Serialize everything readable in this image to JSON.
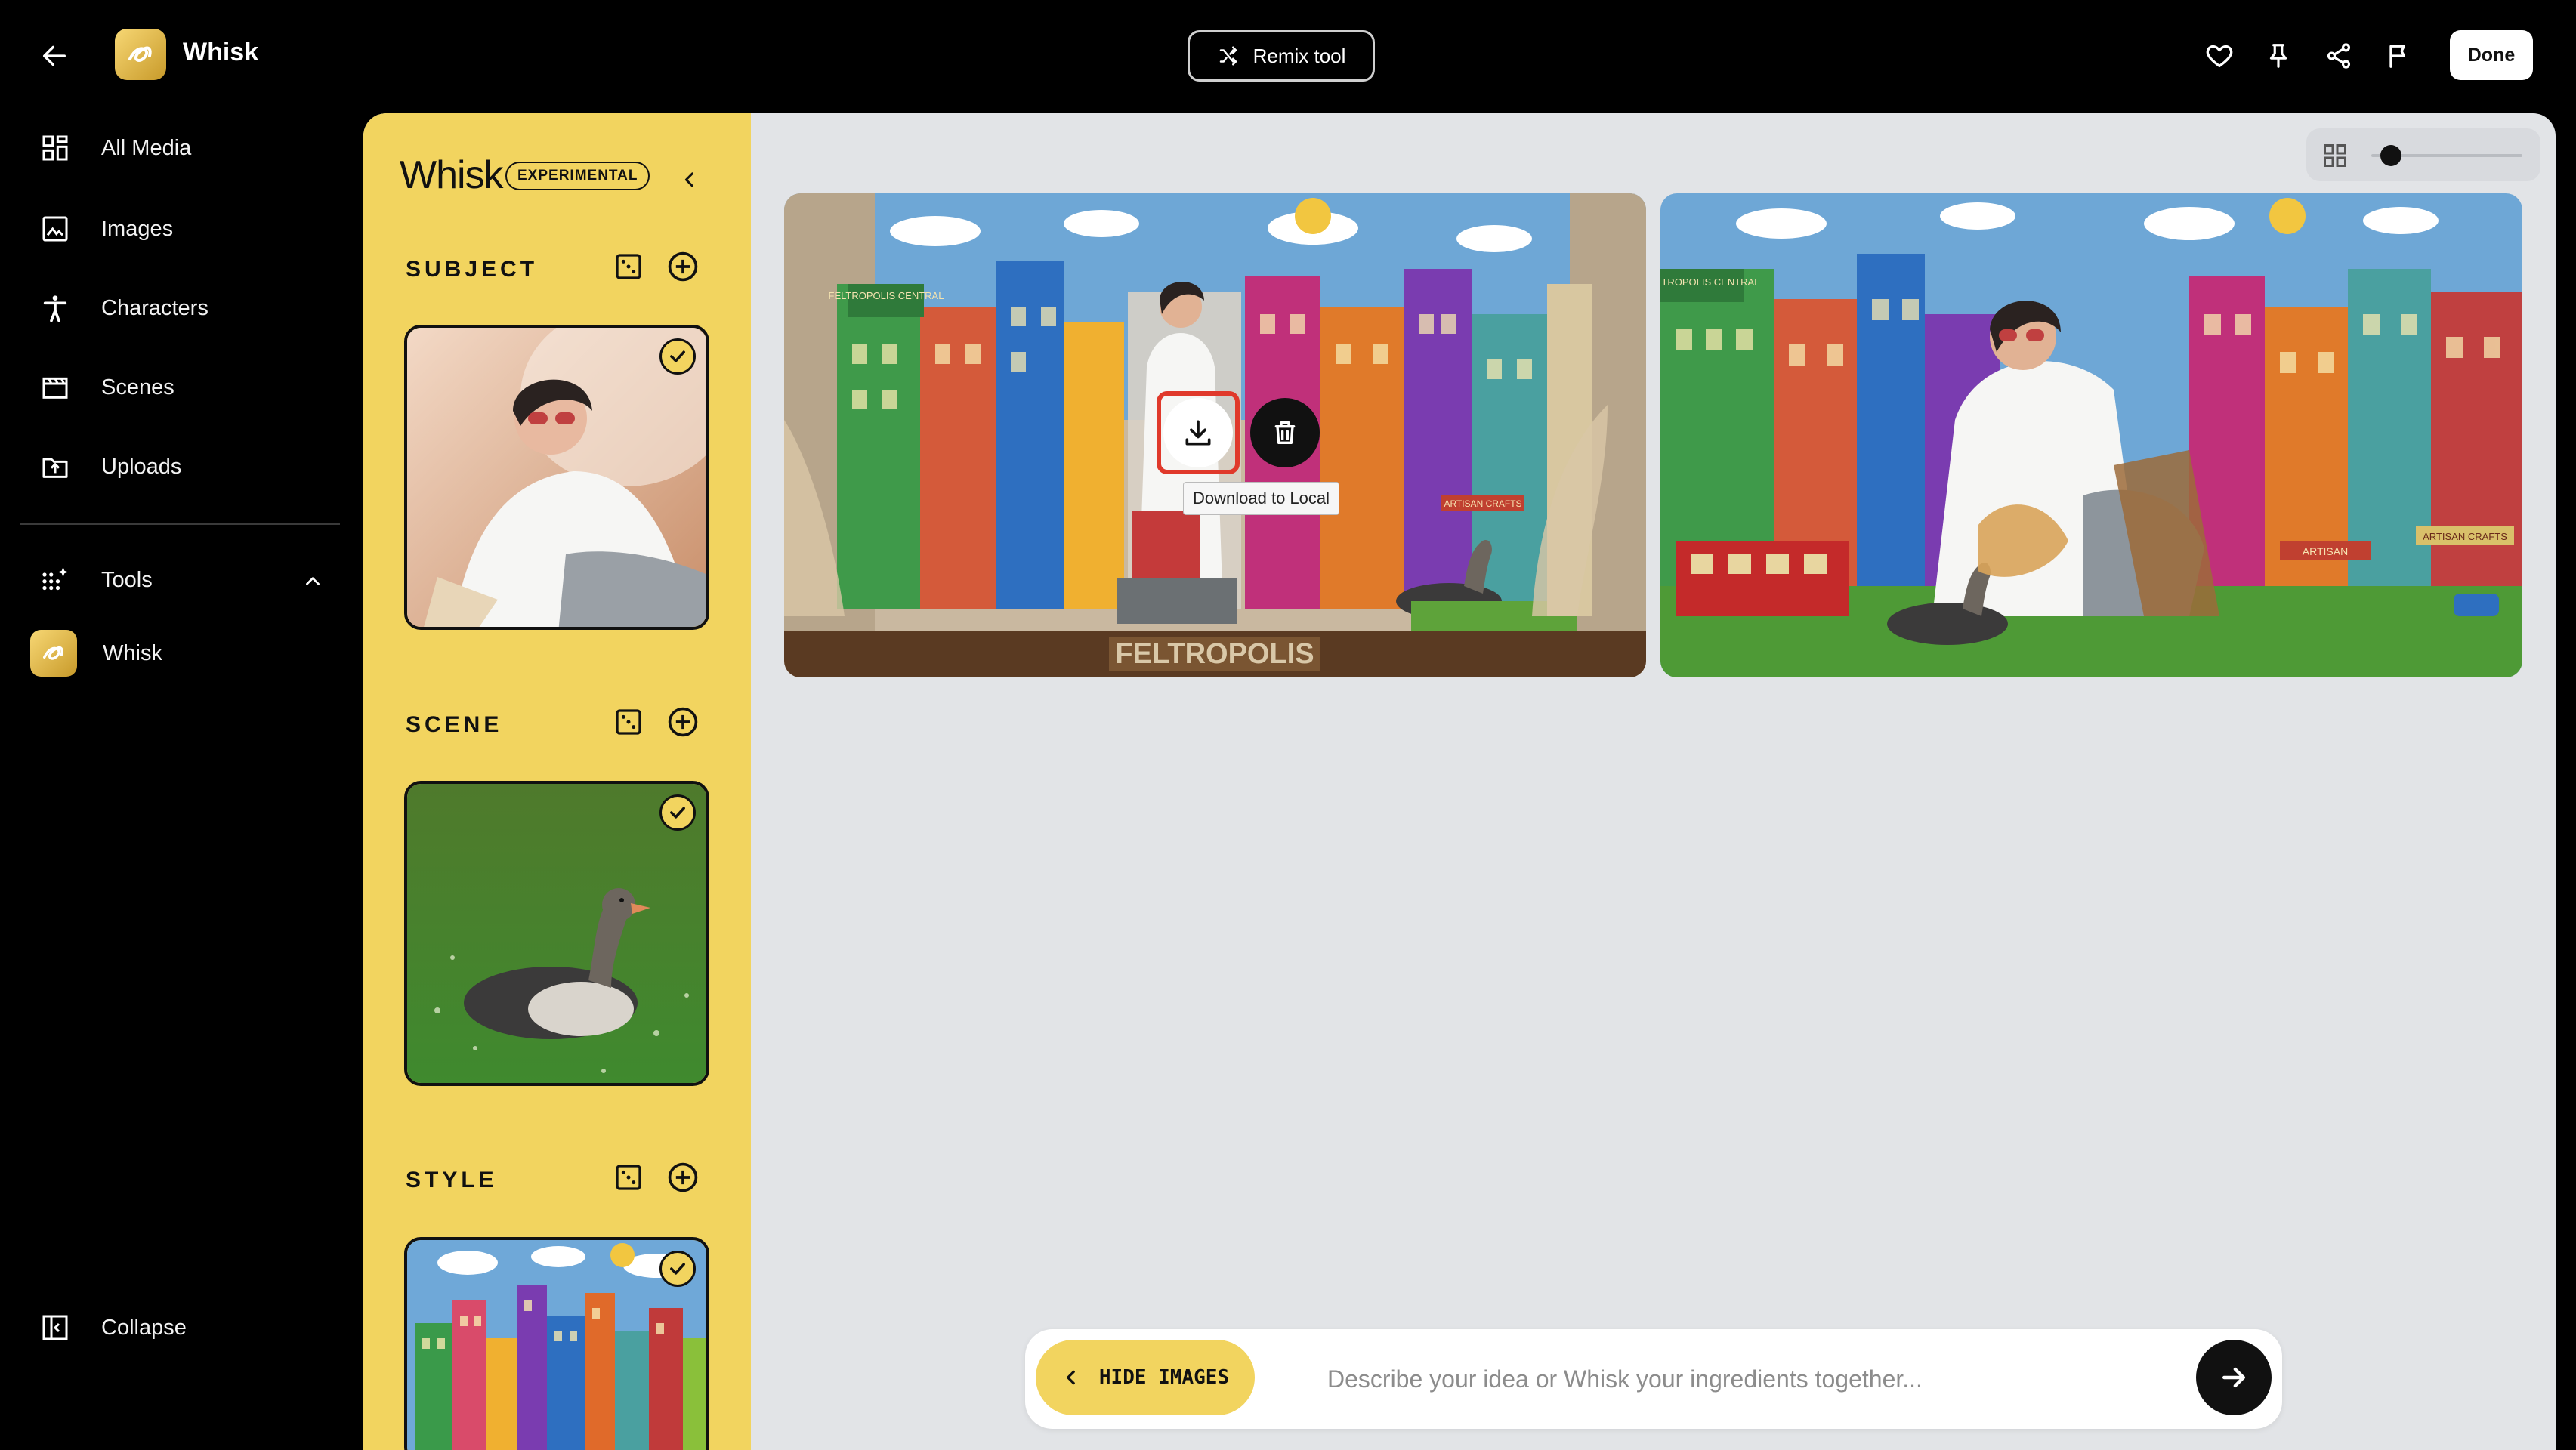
{
  "header": {
    "app_title": "Whisk",
    "remix_label": "Remix tool",
    "done_label": "Done"
  },
  "sidebar": {
    "items": [
      {
        "label": "All Media",
        "icon": "grid-icon"
      },
      {
        "label": "Images",
        "icon": "image-icon"
      },
      {
        "label": "Characters",
        "icon": "person-icon"
      },
      {
        "label": "Scenes",
        "icon": "clapperboard-icon"
      },
      {
        "label": "Uploads",
        "icon": "upload-folder-icon"
      }
    ],
    "tools_label": "Tools",
    "whisk_label": "Whisk",
    "collapse_label": "Collapse"
  },
  "ingredients": {
    "title": "Whisk",
    "badge": "EXPERIMENTAL",
    "sections": [
      {
        "label": "SUBJECT"
      },
      {
        "label": "SCENE"
      },
      {
        "label": "STYLE"
      }
    ]
  },
  "gallery": {
    "image_signs": {
      "sign1": "FELTROPOLIS CENTRAL",
      "sign2": "ARTISAN CRAFTS",
      "base": "FELTROPOLIS",
      "sign3": "ARTISAN"
    },
    "tooltip": "Download to Local"
  },
  "prompt": {
    "hide_label": "HIDE IMAGES",
    "placeholder": "Describe your idea or Whisk your ingredients together..."
  },
  "colors": {
    "accent_yellow": "#f2d45f",
    "highlight_red": "#e0392b",
    "canvas_bg": "#e2e4e7"
  }
}
